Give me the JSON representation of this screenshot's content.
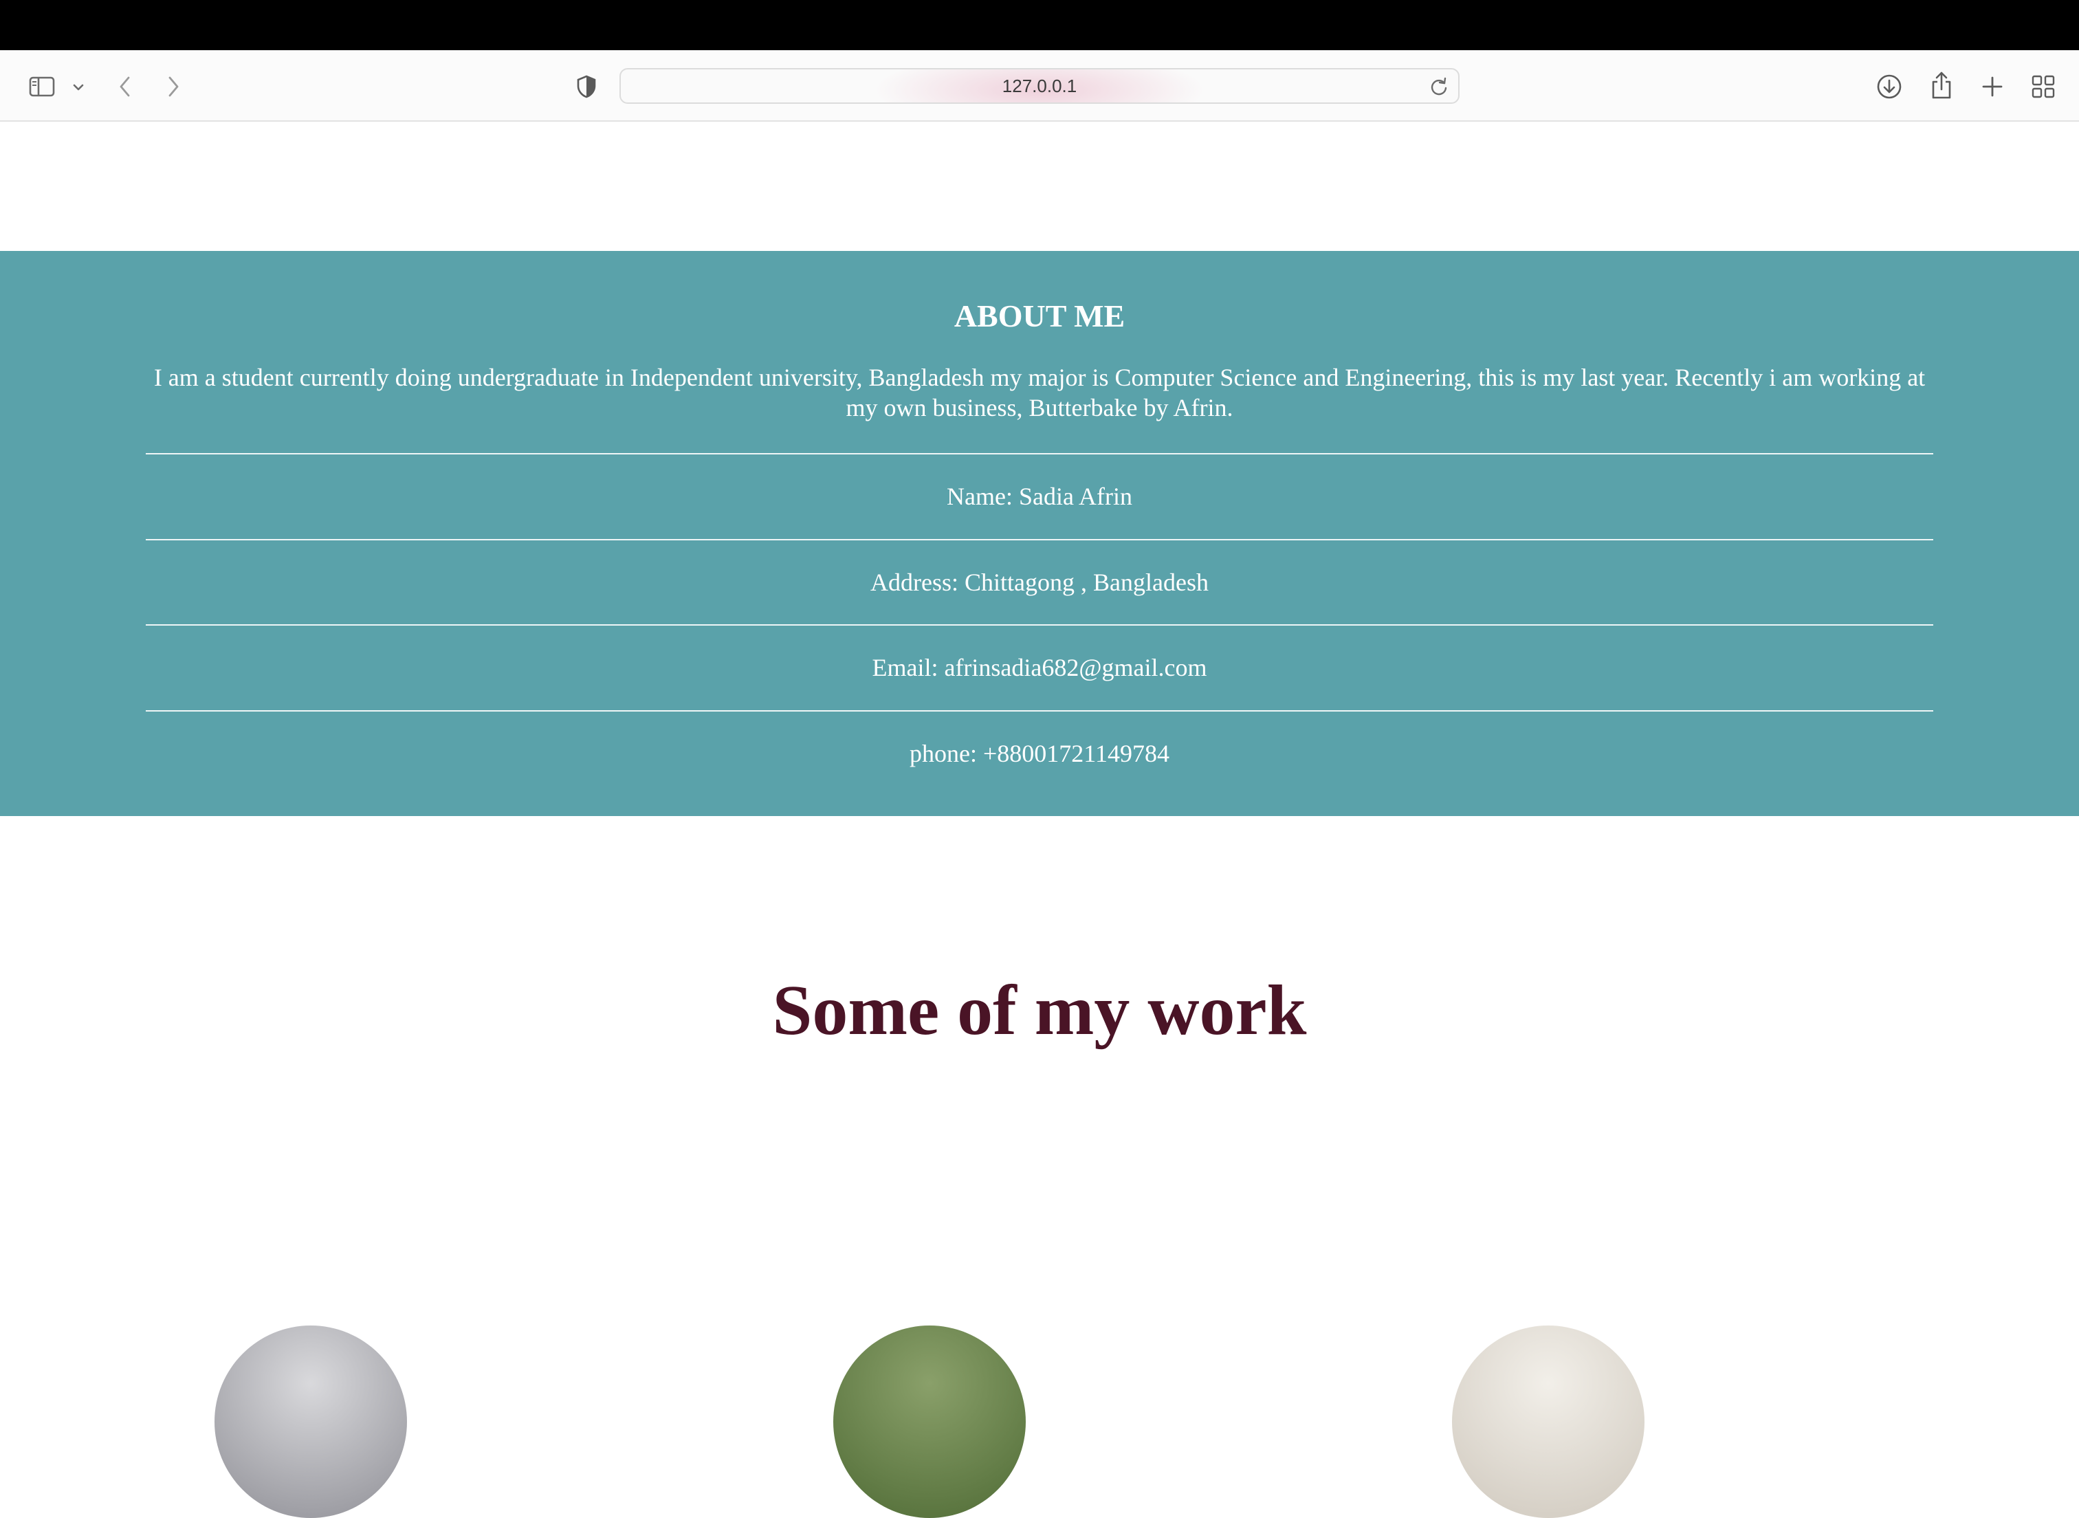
{
  "browser": {
    "url": "127.0.0.1",
    "icons": {
      "sidebar": "sidebar-icon",
      "sidebar_menu": "chevron-down-icon",
      "back": "chevron-left-icon",
      "forward": "chevron-right-icon",
      "privacy": "shield-icon",
      "reload": "reload-icon",
      "downloads": "download-icon",
      "share": "share-icon",
      "new_tab": "plus-icon",
      "tab_overview": "grid-icon"
    }
  },
  "about": {
    "title": "ABOUT ME",
    "bio": "I am a student currently doing undergraduate in Independent university, Bangladesh my major is Computer Science and Engineering, this is my last year. Recently i am working at my own business, Butterbake by Afrin.",
    "name": "Name: Sadia Afrin",
    "address": "Address: Chittagong , Bangladesh",
    "email": "Email: afrinsadia682@gmail.com",
    "phone": "phone: +88001721149784",
    "background_color": "#5aa2aa"
  },
  "work": {
    "title": "Some of my work",
    "title_color": "#4a1426"
  }
}
